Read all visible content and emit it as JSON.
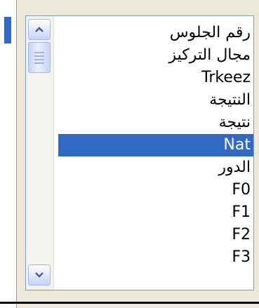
{
  "listbox": {
    "items": [
      {
        "label": "رقم الجلوس"
      },
      {
        "label": "مجال التركيز"
      },
      {
        "label": "Trkeez"
      },
      {
        "label": "النتيجة"
      },
      {
        "label": "نتيجة"
      },
      {
        "label": "Nat"
      },
      {
        "label": "الدور"
      },
      {
        "label": "F0"
      },
      {
        "label": "F1"
      },
      {
        "label": "F2"
      },
      {
        "label": "F3"
      }
    ],
    "selected_index": 5,
    "scroll_position": 0.05
  },
  "icons": {
    "scroll_up": "chevron-up-icon",
    "scroll_down": "chevron-down-icon",
    "thumb": "scroll-thumb-grip"
  },
  "colors": {
    "selection": "#316ac5",
    "border": "#7f9db9",
    "window": "#ece9d8"
  }
}
